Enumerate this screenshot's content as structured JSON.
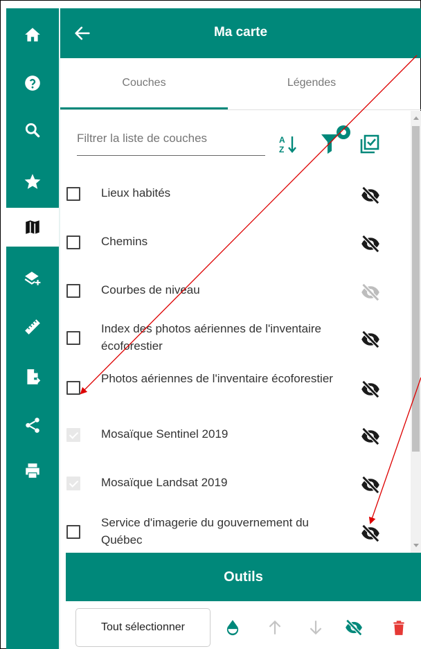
{
  "header": {
    "title": "Ma carte"
  },
  "tabs": [
    {
      "label": "Couches"
    },
    {
      "label": "Légendes"
    }
  ],
  "filter": {
    "placeholder": "Filtrer la liste de couches"
  },
  "layers": [
    {
      "label": "Lieux habités",
      "checked": false,
      "eye": "dark"
    },
    {
      "label": "Chemins",
      "checked": false,
      "eye": "dark"
    },
    {
      "label": "Courbes de niveau",
      "checked": false,
      "eye": "light"
    },
    {
      "label": "Index des photos aériennes de l'inventaire écoforestier",
      "checked": false,
      "eye": "dark"
    },
    {
      "label": "Photos aériennes de l'inventaire écoforestier",
      "checked": false,
      "eye": "dark"
    },
    {
      "label": "Mosaïque Sentinel 2019",
      "checked": true,
      "eye": "dark"
    },
    {
      "label": "Mosaïque Landsat 2019",
      "checked": true,
      "eye": "dark"
    },
    {
      "label": "Service d'imagerie du gouvernement du Québec",
      "checked": false,
      "eye": "dark"
    }
  ],
  "footer": {
    "tools_label": "Outils",
    "select_all_label": "Tout sélectionner"
  },
  "sidebar_icons": [
    "home-icon",
    "help-icon",
    "search-icon",
    "star-icon",
    "map-icon",
    "add-layer-icon",
    "measure-icon",
    "export-icon",
    "share-icon",
    "print-icon"
  ],
  "colors": {
    "primary": "#00887a",
    "delete": "#e53935",
    "annotation_arrow": "#dd0000"
  }
}
